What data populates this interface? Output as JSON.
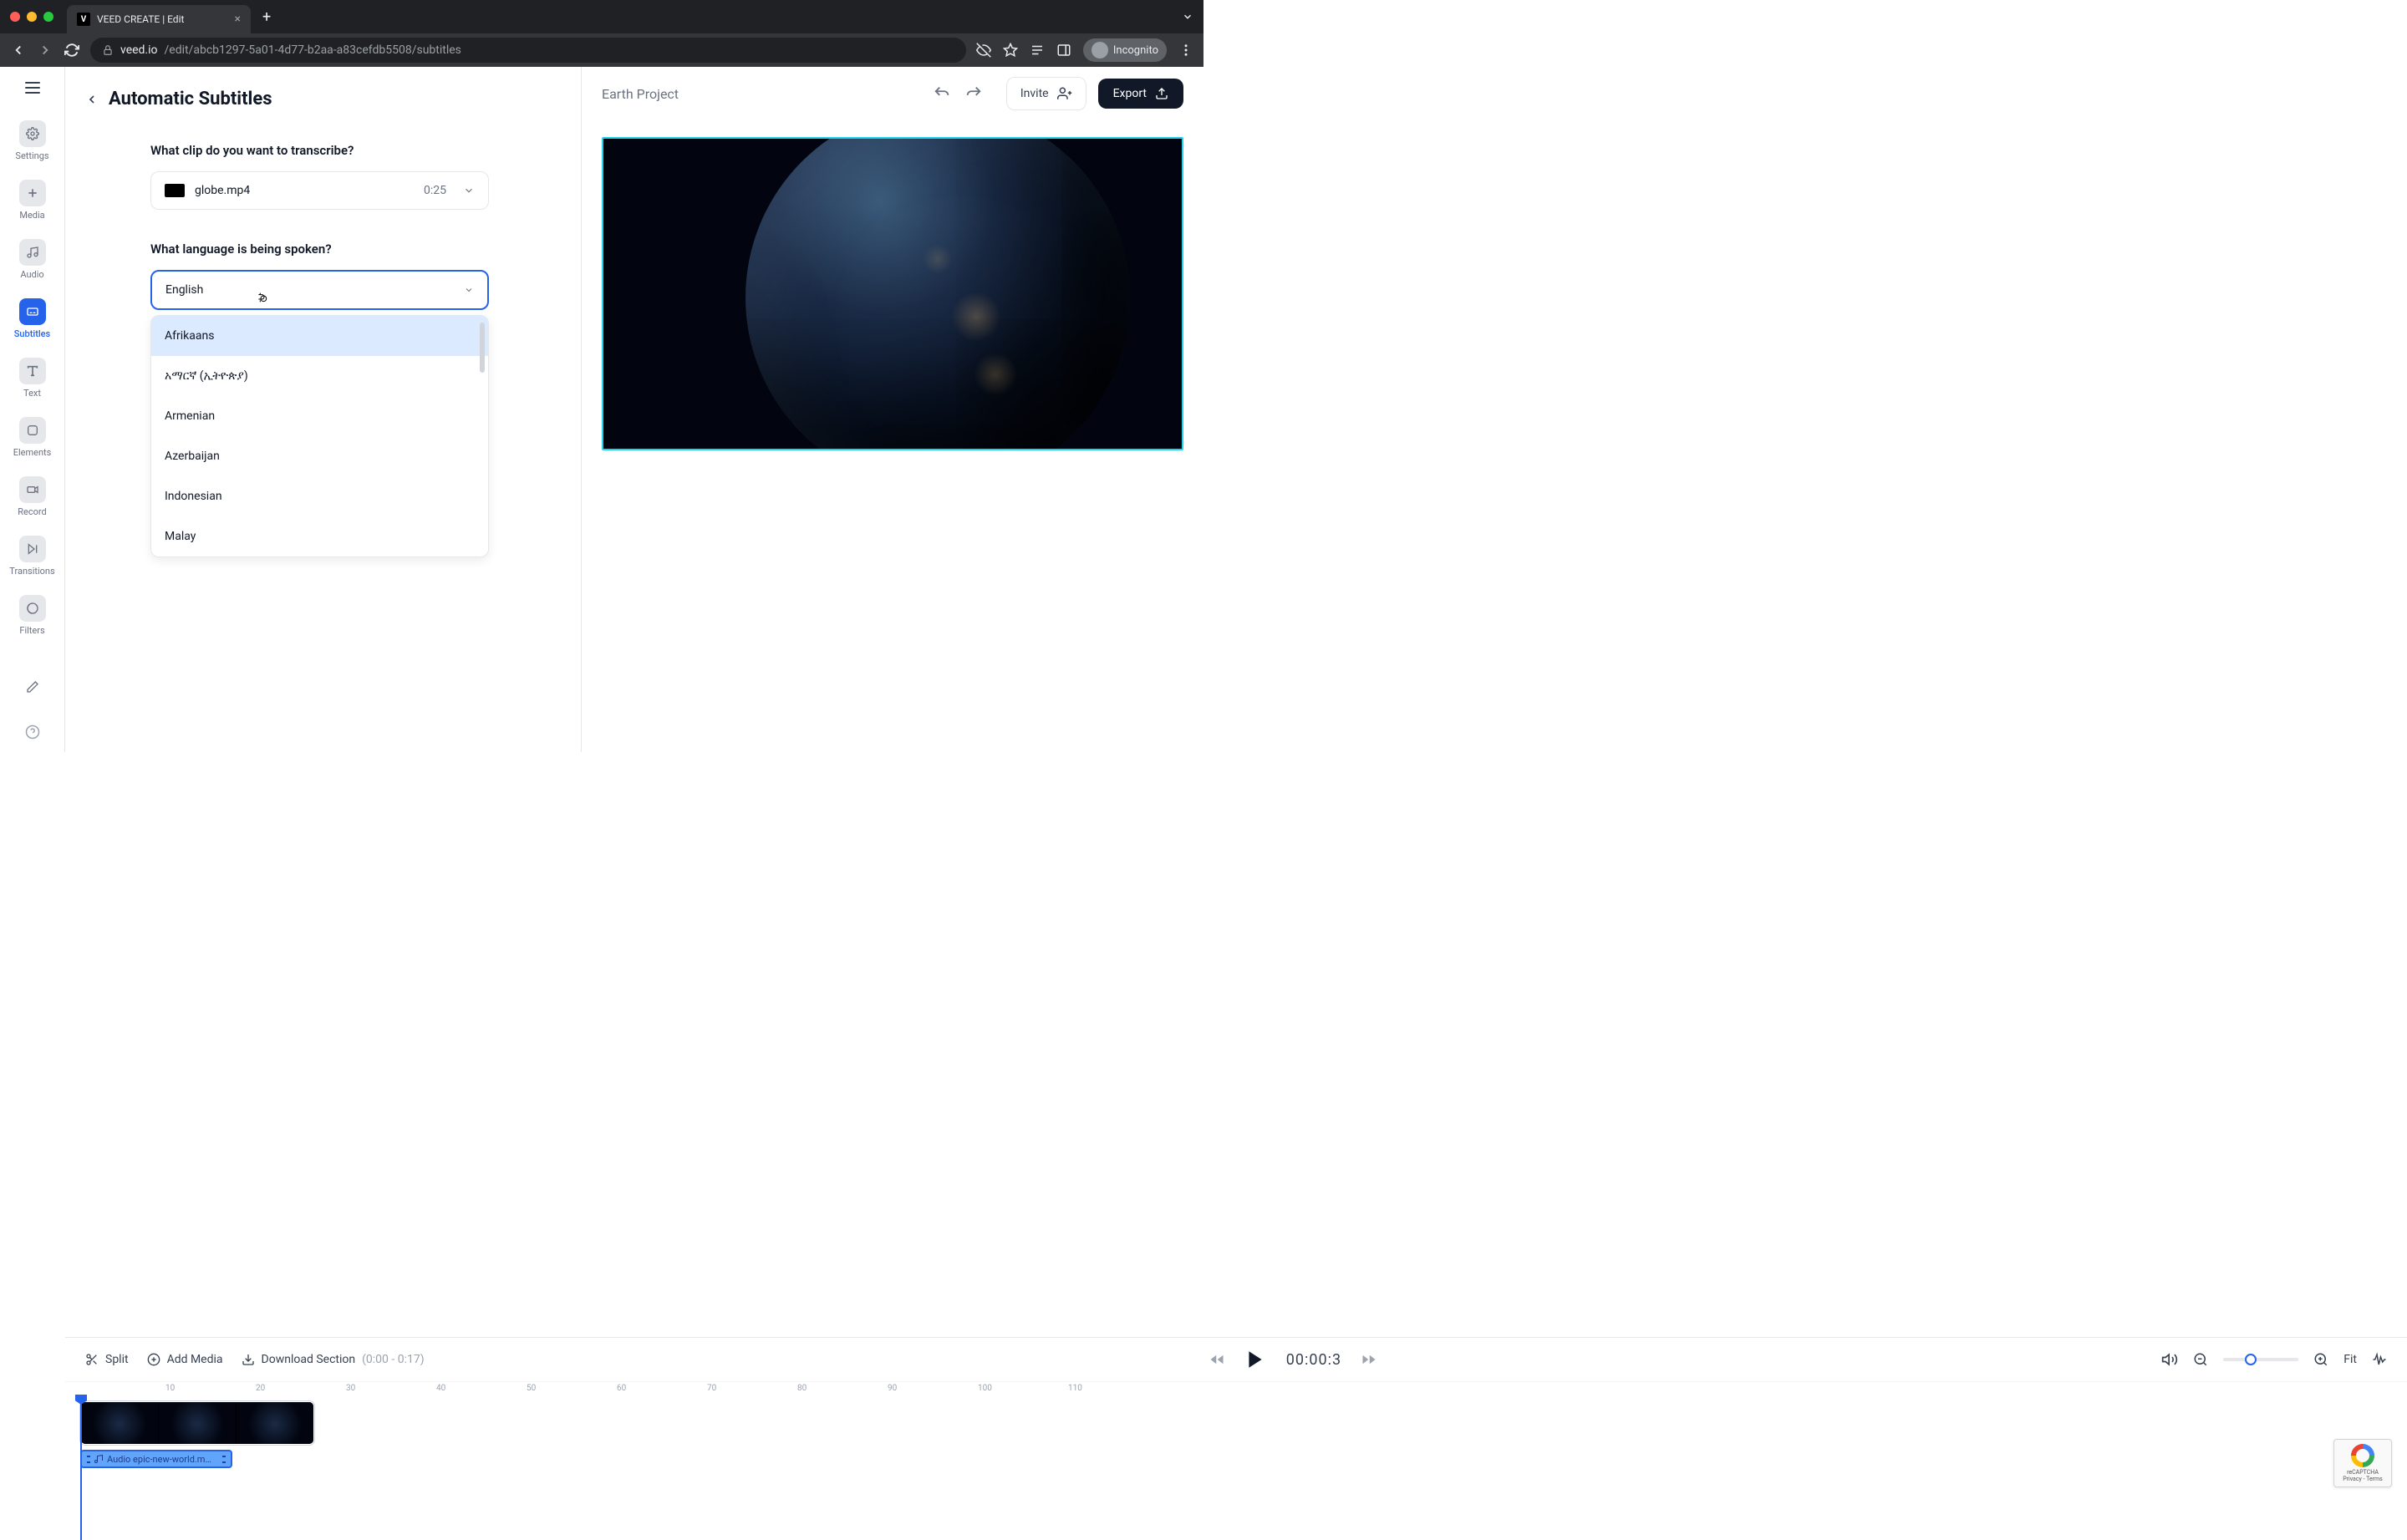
{
  "browser": {
    "tab_title": "VEED CREATE | Edit",
    "url_domain": "veed.io",
    "url_path": "/edit/abcb1297-5a01-4d77-b2aa-a83cefdb5508/subtitles",
    "incognito_label": "Incognito"
  },
  "sidebar": {
    "items": [
      {
        "label": "Settings"
      },
      {
        "label": "Media"
      },
      {
        "label": "Audio"
      },
      {
        "label": "Subtitles"
      },
      {
        "label": "Text"
      },
      {
        "label": "Elements"
      },
      {
        "label": "Record"
      },
      {
        "label": "Transitions"
      },
      {
        "label": "Filters"
      }
    ]
  },
  "panel": {
    "title": "Automatic Subtitles",
    "q_clip": "What clip do you want to transcribe?",
    "clip_name": "globe.mp4",
    "clip_duration": "0:25",
    "q_lang": "What language is being spoken?",
    "lang_value": "English",
    "lang_options": [
      "Afrikaans",
      "አማርኛ (ኢትዮጵያ)",
      "Armenian",
      "Azerbaijan",
      "Indonesian",
      "Malay"
    ]
  },
  "topbar": {
    "project_name": "Earth Project",
    "invite_label": "Invite",
    "export_label": "Export"
  },
  "toolbar": {
    "split_label": "Split",
    "add_media_label": "Add Media",
    "download_section_label": "Download Section",
    "download_range": "(0:00 - 0:17)",
    "time_display": "00:00:3",
    "fit_label": "Fit"
  },
  "ruler": {
    "marks": [
      "10",
      "20",
      "30",
      "40",
      "50",
      "60",
      "70",
      "80",
      "90",
      "100",
      "110"
    ]
  },
  "audio_clip": {
    "label": "Audio epic-new-world.m…"
  },
  "recaptcha": {
    "line1": "reCAPTCHA",
    "line2": "Privacy - Terms"
  }
}
